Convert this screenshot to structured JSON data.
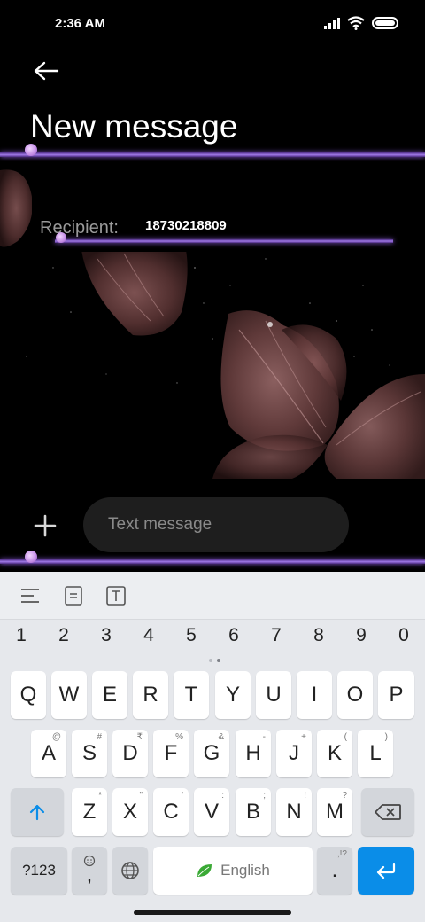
{
  "status_bar": {
    "time": "2:36 AM"
  },
  "header": {
    "title": "New message"
  },
  "recipient": {
    "label": "Recipient:",
    "value": "18730218809"
  },
  "compose": {
    "placeholder": "Text message"
  },
  "keyboard": {
    "numbers": [
      "1",
      "2",
      "3",
      "4",
      "5",
      "6",
      "7",
      "8",
      "9",
      "0"
    ],
    "row1": [
      {
        "key": "Q",
        "hint": ""
      },
      {
        "key": "W",
        "hint": ""
      },
      {
        "key": "E",
        "hint": ""
      },
      {
        "key": "R",
        "hint": ""
      },
      {
        "key": "T",
        "hint": ""
      },
      {
        "key": "Y",
        "hint": ""
      },
      {
        "key": "U",
        "hint": ""
      },
      {
        "key": "I",
        "hint": ""
      },
      {
        "key": "O",
        "hint": ""
      },
      {
        "key": "P",
        "hint": ""
      }
    ],
    "row2": [
      {
        "key": "A",
        "hint": "@"
      },
      {
        "key": "S",
        "hint": "#"
      },
      {
        "key": "D",
        "hint": "₹"
      },
      {
        "key": "F",
        "hint": "%"
      },
      {
        "key": "G",
        "hint": "&"
      },
      {
        "key": "H",
        "hint": "-"
      },
      {
        "key": "J",
        "hint": "+"
      },
      {
        "key": "K",
        "hint": "("
      },
      {
        "key": "L",
        "hint": ")"
      }
    ],
    "row3": [
      {
        "key": "Z",
        "hint": "*"
      },
      {
        "key": "X",
        "hint": "\""
      },
      {
        "key": "C",
        "hint": "'"
      },
      {
        "key": "V",
        "hint": ":"
      },
      {
        "key": "B",
        "hint": ";"
      },
      {
        "key": "N",
        "hint": "!"
      },
      {
        "key": "M",
        "hint": "?"
      }
    ],
    "symbols_label": "?123",
    "comma_label": ",",
    "space_label": "English",
    "period_label": ".",
    "period_hint": ",!?"
  },
  "colors": {
    "accent": "#0a8de8",
    "neon": "#a17ae8"
  },
  "icons": {
    "back": "arrow-left-icon",
    "add": "plus-icon",
    "toolbar": [
      "align-left-icon",
      "text-box-icon",
      "text-format-icon"
    ],
    "shift": "arrow-up-icon",
    "backspace": "backspace-icon",
    "emoji": "emoji-icon",
    "globe": "globe-icon",
    "leaf": "leaf-icon",
    "enter": "enter-icon"
  }
}
